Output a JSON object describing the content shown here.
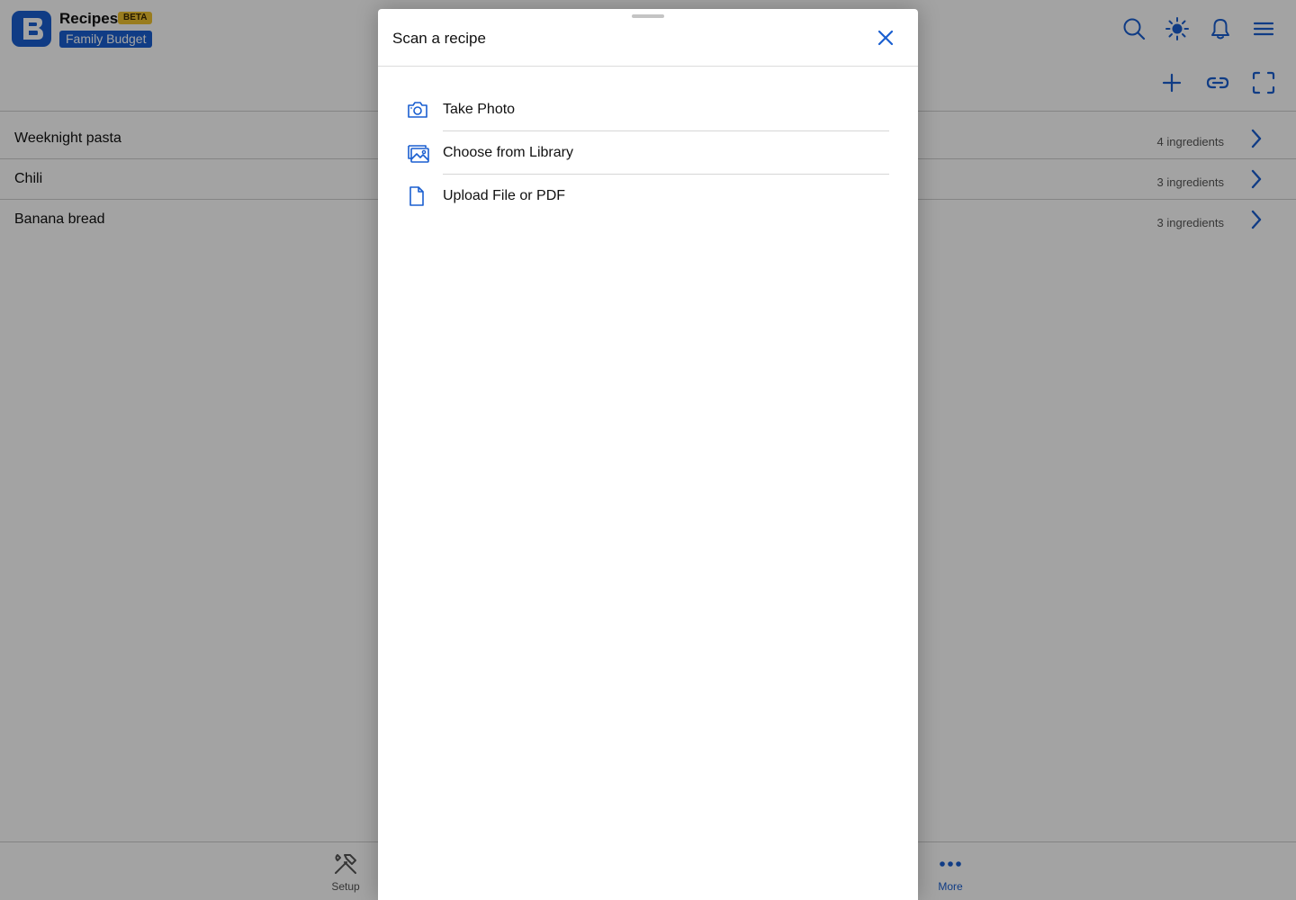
{
  "app": {
    "title": "Recipes",
    "beta_badge": "BETA",
    "budget_name": "Family Budget"
  },
  "header_icons": [
    "search-icon",
    "sun-icon",
    "bell-icon",
    "menu-icon"
  ],
  "toolbar_icons": [
    "plus-icon",
    "link-icon",
    "scan-frame-icon"
  ],
  "recipes": [
    {
      "name": "Weeknight pasta",
      "count": "4 ingredients"
    },
    {
      "name": "Chili",
      "count": "3 ingredients"
    },
    {
      "name": "Banana bread",
      "count": "3 ingredients"
    }
  ],
  "bottom_nav": {
    "setup_label": "Setup",
    "more_label": "More"
  },
  "modal": {
    "title": "Scan a recipe",
    "options": [
      {
        "label": "Take Photo",
        "icon": "camera-icon"
      },
      {
        "label": "Choose from Library",
        "icon": "image-library-icon"
      },
      {
        "label": "Upload File or PDF",
        "icon": "file-icon"
      }
    ]
  },
  "colors": {
    "accent": "#1a5fd0",
    "beta": "#f0c230",
    "overlay": "rgba(0,0,0,0.36)"
  }
}
